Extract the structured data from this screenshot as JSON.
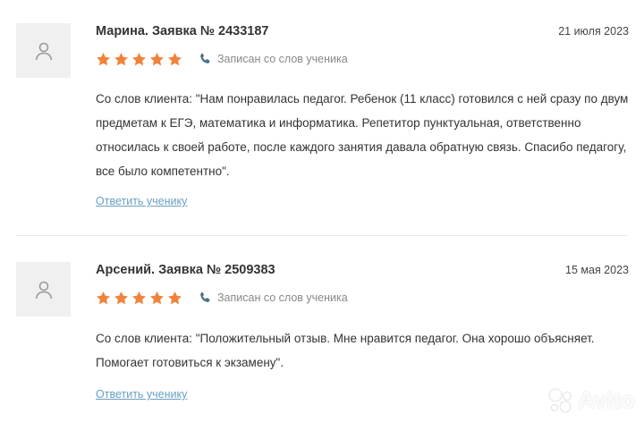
{
  "reviews": [
    {
      "name": "Марина. Заявка № 2433187",
      "date": "21 июля 2023",
      "rating": 5,
      "source": "Записан со слов ученика",
      "text": "Со слов клиента: \"Нам понравилась педагог. Ребенок (11 класс) готовился с ней сразу по двум предметам к ЕГЭ, математика и информатика. Репетитор пунктуальная, ответственно относилась к своей работе, после каждого занятия давала обратную связь. Спасибо педагогу, все было компетентно\".",
      "reply": "Ответить ученику"
    },
    {
      "name": "Арсений. Заявка № 2509383",
      "date": "15 мая 2023",
      "rating": 5,
      "source": "Записан со слов ученика",
      "text": "Со слов клиента: \"Положительный отзыв. Мне нравится педагог. Она хорошо объясняет. Помогает готовиться к экзамену\".",
      "reply": "Ответить ученику"
    }
  ],
  "colors": {
    "star": "#f0833a",
    "link": "#6a9ec4",
    "phone_icon": "#4a6f8a"
  },
  "watermark": {
    "text": "Avito",
    "icon": "avito-logo-icon"
  }
}
